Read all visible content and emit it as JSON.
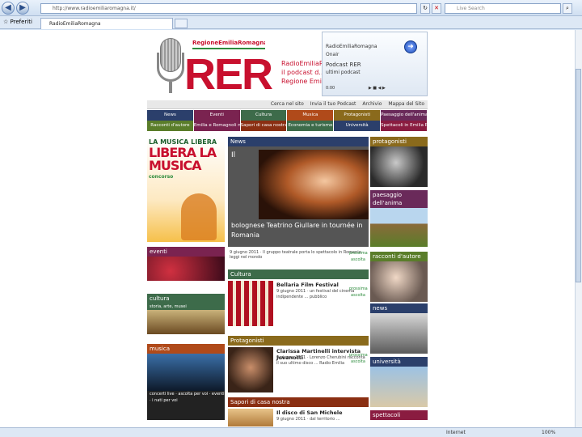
{
  "browser": {
    "address": "http://www.radioemiliaromagna.it/",
    "search_placeholder": "Live Search",
    "favorites_label": "Preferiti",
    "tab_title": "RadioEmiliaRomagna",
    "status_zone": "Internet",
    "zoom": "100%"
  },
  "header": {
    "brand_band": "RegioneEmiliaRomagna",
    "logo_text": "RER",
    "tagline": "RadioEmiliaR… il podcast d… Regione Emi…"
  },
  "podcast": {
    "line1": "RadioEmiliaRomagna",
    "line2": "Onair",
    "line3": "Podcast RER",
    "line4": "ultimi podcast",
    "time": "0:00",
    "controls": "▶ ■ ◀ ▶"
  },
  "utility": [
    "Cerca nel sito",
    "Invia il tuo Podcast",
    "Archivio",
    "Mappa del Sito"
  ],
  "nav1": [
    {
      "label": "News",
      "color": "#2b3f6b"
    },
    {
      "label": "Eventi",
      "color": "#7a2350"
    },
    {
      "label": "Cultura",
      "color": "#3d6b4a"
    },
    {
      "label": "Musica",
      "color": "#b04a1a"
    },
    {
      "label": "Protagonisti",
      "color": "#8a6a1c"
    },
    {
      "label": "Paesaggio dell'anima",
      "color": "#6a2a5a"
    }
  ],
  "nav2": [
    {
      "label": "Racconti d'autore",
      "color": "#5a7d2a"
    },
    {
      "label": "Emilia e Romagnoli nel mondo",
      "color": "#7a2350"
    },
    {
      "label": "Sapori di casa nostra",
      "color": "#8a2f12"
    },
    {
      "label": "Economia e turismo",
      "color": "#3d6b4a"
    },
    {
      "label": "Università",
      "color": "#2b3f6b"
    },
    {
      "label": "Spettacoli in Emilia Romagna",
      "color": "#8a1c40"
    }
  ],
  "left": {
    "promo_1": "LA MUSICA LIBERA",
    "promo_2": "LIBERA LA MUSICA",
    "promo_3": "concorso",
    "eventi": "eventi",
    "cultura": "cultura",
    "cultura_sub": "storia, arte, musei",
    "musica": "musica",
    "musica_sub": "concerti live · ascolta per voi · eventi · i nati per voi"
  },
  "center": {
    "news_header": "News",
    "news_title_fragment": "Il",
    "news_caption": "bolognese Teatrino Giullare in tournée in Romania",
    "news_meta": "9 giugno 2011 · Il gruppo teatrale porta lo spettacolo in Romania · leggi nel mondo",
    "ascolta": "prossima ascolta",
    "cultura_header": "Cultura",
    "cultura_title": "Bellaria Film Festival",
    "cultura_desc": "9 giugno 2011 · un festival del cinema indipendente ... pubblico",
    "prot_header": "Protagonisti",
    "prot_title": "Clarissa Martinelli intervista Jovanotti",
    "prot_desc": "9 giugno 2011 · Lorenzo Cherubini racconta il suo ultimo disco ... Radio Emilia",
    "sapori_header": "Sapori di casa nostra",
    "sapori_title": "Il disco di San Michele",
    "sapori_desc": "9 giugno 2011 · dal territorio ..."
  },
  "right": {
    "protagonisti": "protagonisti",
    "paesaggio": "paesaggio dell'anima",
    "racconti": "racconti d'autore",
    "news": "news",
    "universita": "università",
    "spettacoli": "spettacoli"
  }
}
